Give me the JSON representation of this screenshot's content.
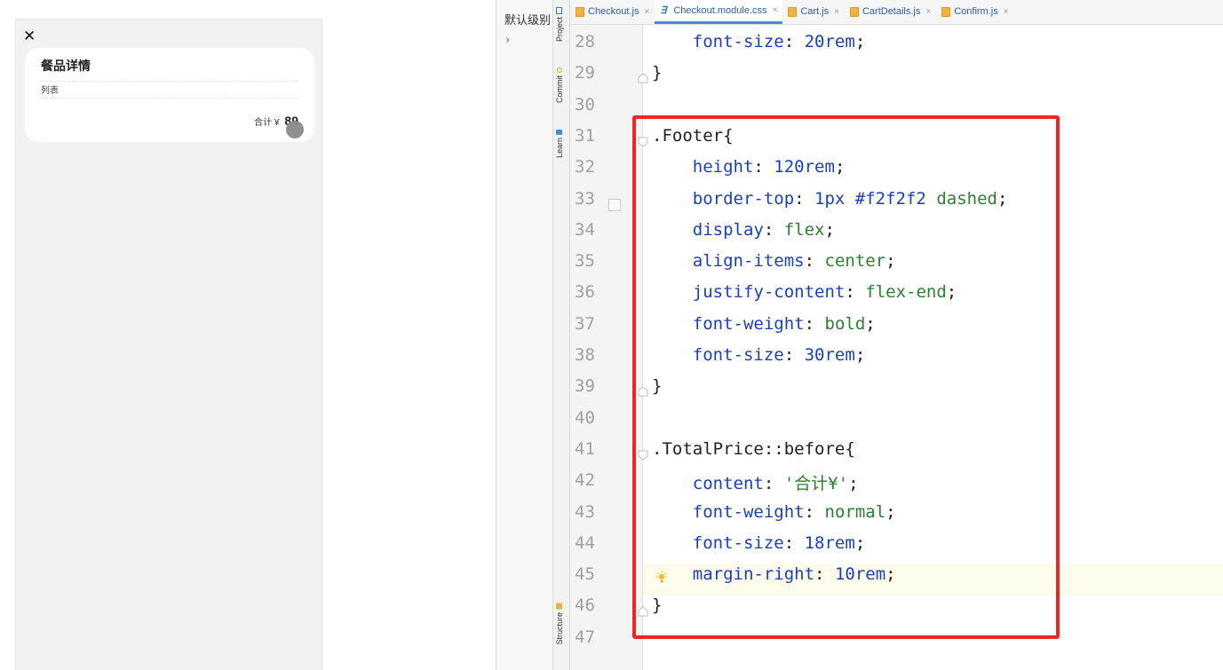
{
  "browser_preview": {
    "close_label": "✕",
    "card_title": "餐品详情",
    "list_text": "列表",
    "total_label": "合计 ¥",
    "total_value": "89"
  },
  "project_panel": {
    "title": "默认级别",
    "expand_arrow": "›"
  },
  "tool_tabs": {
    "project": "Project",
    "commit": "Commit",
    "learn": "Learn",
    "structure": "Structure"
  },
  "editor_tabs": [
    {
      "label": "Checkout.js",
      "active": false,
      "icon": "js-file-icon"
    },
    {
      "label": "Checkout.module.css",
      "active": true,
      "icon": "css-file-icon"
    },
    {
      "label": "Cart.js",
      "active": false,
      "icon": "js-file-icon"
    },
    {
      "label": "CartDetails.js",
      "active": false,
      "icon": "js-file-icon"
    },
    {
      "label": "Confirm.js",
      "active": false,
      "icon": "js-file-icon"
    }
  ],
  "tab_close_glyph": "×",
  "code_lines": [
    {
      "n": "28",
      "tokens": [
        [
          "    ",
          ""
        ],
        [
          "font-size",
          "prop"
        ],
        [
          ": ",
          "punc"
        ],
        [
          "20rem",
          "num"
        ],
        [
          ";",
          "punc"
        ]
      ]
    },
    {
      "n": "29",
      "tokens": [
        [
          "}",
          "punc"
        ]
      ]
    },
    {
      "n": "30",
      "tokens": []
    },
    {
      "n": "31",
      "tokens": [
        [
          ".Footer",
          "sel"
        ],
        [
          "{",
          "punc"
        ]
      ]
    },
    {
      "n": "32",
      "tokens": [
        [
          "    ",
          ""
        ],
        [
          "height",
          "prop"
        ],
        [
          ": ",
          "punc"
        ],
        [
          "120rem",
          "num"
        ],
        [
          ";",
          "punc"
        ]
      ]
    },
    {
      "n": "33",
      "tokens": [
        [
          "    ",
          ""
        ],
        [
          "border-top",
          "prop"
        ],
        [
          ": ",
          "punc"
        ],
        [
          "1px #f2f2f2 ",
          "num"
        ],
        [
          "dashed",
          "val"
        ],
        [
          ";",
          "punc"
        ]
      ]
    },
    {
      "n": "34",
      "tokens": [
        [
          "    ",
          ""
        ],
        [
          "display",
          "prop"
        ],
        [
          ": ",
          "punc"
        ],
        [
          "flex",
          "val"
        ],
        [
          ";",
          "punc"
        ]
      ]
    },
    {
      "n": "35",
      "tokens": [
        [
          "    ",
          ""
        ],
        [
          "align-items",
          "prop"
        ],
        [
          ": ",
          "punc"
        ],
        [
          "center",
          "val"
        ],
        [
          ";",
          "punc"
        ]
      ]
    },
    {
      "n": "36",
      "tokens": [
        [
          "    ",
          ""
        ],
        [
          "justify-content",
          "prop"
        ],
        [
          ": ",
          "punc"
        ],
        [
          "flex-end",
          "val"
        ],
        [
          ";",
          "punc"
        ]
      ]
    },
    {
      "n": "37",
      "tokens": [
        [
          "    ",
          ""
        ],
        [
          "font-weight",
          "prop"
        ],
        [
          ": ",
          "punc"
        ],
        [
          "bold",
          "val"
        ],
        [
          ";",
          "punc"
        ]
      ]
    },
    {
      "n": "38",
      "tokens": [
        [
          "    ",
          ""
        ],
        [
          "font-size",
          "prop"
        ],
        [
          ": ",
          "punc"
        ],
        [
          "30rem",
          "num"
        ],
        [
          ";",
          "punc"
        ]
      ]
    },
    {
      "n": "39",
      "tokens": [
        [
          "}",
          "punc"
        ]
      ]
    },
    {
      "n": "40",
      "tokens": []
    },
    {
      "n": "41",
      "tokens": [
        [
          ".TotalPrice::before",
          "sel"
        ],
        [
          "{",
          "punc"
        ]
      ]
    },
    {
      "n": "42",
      "tokens": [
        [
          "    ",
          ""
        ],
        [
          "content",
          "prop"
        ],
        [
          ": ",
          "punc"
        ],
        [
          "'合计¥'",
          "str"
        ],
        [
          ";",
          "punc"
        ]
      ]
    },
    {
      "n": "43",
      "tokens": [
        [
          "    ",
          ""
        ],
        [
          "font-weight",
          "prop"
        ],
        [
          ": ",
          "punc"
        ],
        [
          "normal",
          "val"
        ],
        [
          ";",
          "punc"
        ]
      ]
    },
    {
      "n": "44",
      "tokens": [
        [
          "    ",
          ""
        ],
        [
          "font-size",
          "prop"
        ],
        [
          ": ",
          "punc"
        ],
        [
          "18rem",
          "num"
        ],
        [
          ";",
          "punc"
        ]
      ]
    },
    {
      "n": "45",
      "tokens": [
        [
          "    ",
          ""
        ],
        [
          "margin-right",
          "prop"
        ],
        [
          ": ",
          "punc"
        ],
        [
          "10rem",
          "num"
        ],
        [
          ";",
          "punc"
        ]
      ]
    },
    {
      "n": "46",
      "tokens": [
        [
          "}",
          "punc"
        ]
      ]
    },
    {
      "n": "47",
      "tokens": []
    }
  ],
  "colors": {
    "highlight_box": "#f02424",
    "keyword_property": "#1c3fb8",
    "keyword_value": "#2e7d32",
    "active_tab_underline": "#4a86e8"
  }
}
